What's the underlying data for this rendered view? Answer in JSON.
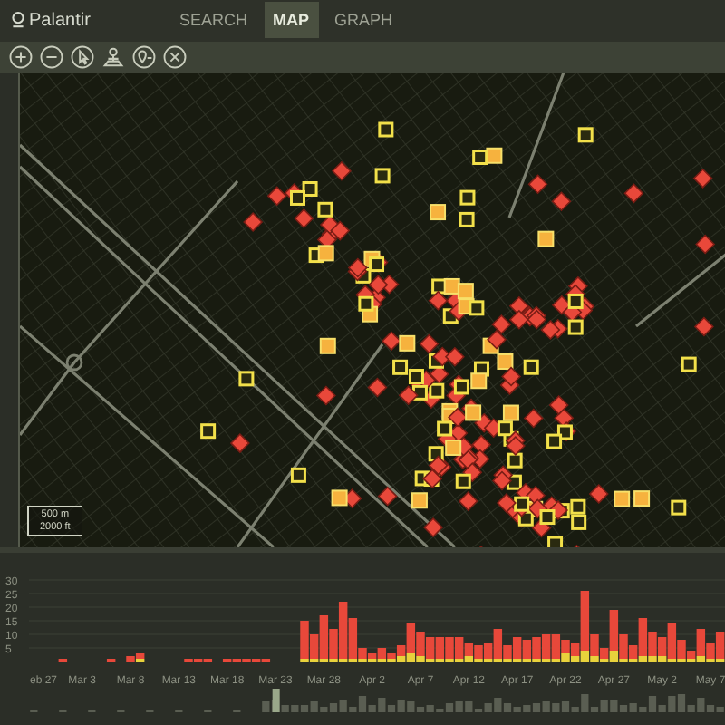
{
  "header": {
    "logo": "Palantir",
    "tabs": [
      {
        "label": "SEARCH",
        "selected": false
      },
      {
        "label": "MAP",
        "selected": true
      },
      {
        "label": "GRAPH",
        "selected": false
      }
    ]
  },
  "toolbar": {
    "tools": [
      {
        "kind": "zoom-in"
      },
      {
        "kind": "zoom-out"
      },
      {
        "kind": "select"
      },
      {
        "kind": "person"
      },
      {
        "kind": "pin"
      },
      {
        "kind": "close"
      }
    ]
  },
  "map": {
    "scale_bar": {
      "metric": "500 m",
      "imperial": "2000 ft"
    }
  },
  "timeline": {
    "chart_data": {
      "type": "bar",
      "stacked": true,
      "categories": [
        null,
        "eb 27",
        null,
        null,
        null,
        "Mar 3",
        null,
        null,
        null,
        null,
        "Mar 8",
        null,
        null,
        null,
        null,
        "Mar 13",
        null,
        null,
        null,
        null,
        "Mar 18",
        null,
        null,
        null,
        null,
        "Mar 23",
        null,
        null,
        null,
        null,
        "Mar 28",
        null,
        null,
        null,
        null,
        "Apr 2",
        null,
        null,
        null,
        null,
        "Apr 7",
        null,
        null,
        null,
        null,
        "Apr 12",
        null,
        null,
        null,
        null,
        "Apr 17",
        null,
        null,
        null,
        null,
        "Apr 22",
        null,
        null,
        null,
        null,
        "Apr 27",
        null,
        null,
        null,
        null,
        "May 2",
        null,
        null,
        null,
        null,
        "May 7",
        null
      ],
      "series": [
        {
          "color": "#e8d23c",
          "values": [
            0,
            0,
            0,
            0,
            0,
            0,
            0,
            0,
            0,
            0,
            0,
            1,
            0,
            0,
            0,
            0,
            0,
            0,
            0,
            0,
            0,
            0,
            0,
            0,
            0,
            0,
            0,
            0,
            1,
            1,
            1,
            1,
            1,
            1,
            1,
            1,
            1,
            1,
            2,
            3,
            2,
            1,
            1,
            1,
            1,
            2,
            1,
            1,
            1,
            1,
            1,
            1,
            1,
            1,
            1,
            3,
            2,
            4,
            2,
            1,
            4,
            1,
            1,
            2,
            2,
            2,
            1,
            1,
            1,
            2,
            1,
            1
          ]
        },
        {
          "color": "#e8483a",
          "values": [
            0,
            0,
            0,
            1,
            0,
            0,
            0,
            0,
            1,
            0,
            2,
            2,
            0,
            0,
            0,
            0,
            1,
            1,
            1,
            0,
            1,
            1,
            1,
            1,
            1,
            0,
            0,
            0,
            14,
            9,
            16,
            11,
            21,
            15,
            4,
            2,
            4,
            2,
            4,
            11,
            9,
            8,
            8,
            8,
            8,
            5,
            5,
            6,
            11,
            5,
            8,
            7,
            8,
            9,
            9,
            5,
            5,
            22,
            8,
            4,
            15,
            9,
            5,
            14,
            9,
            7,
            13,
            7,
            3,
            10,
            6,
            10
          ]
        }
      ],
      "yticks": [
        5,
        10,
        15,
        20,
        25,
        30
      ],
      "ylim": [
        0,
        30
      ],
      "grid": true
    }
  }
}
